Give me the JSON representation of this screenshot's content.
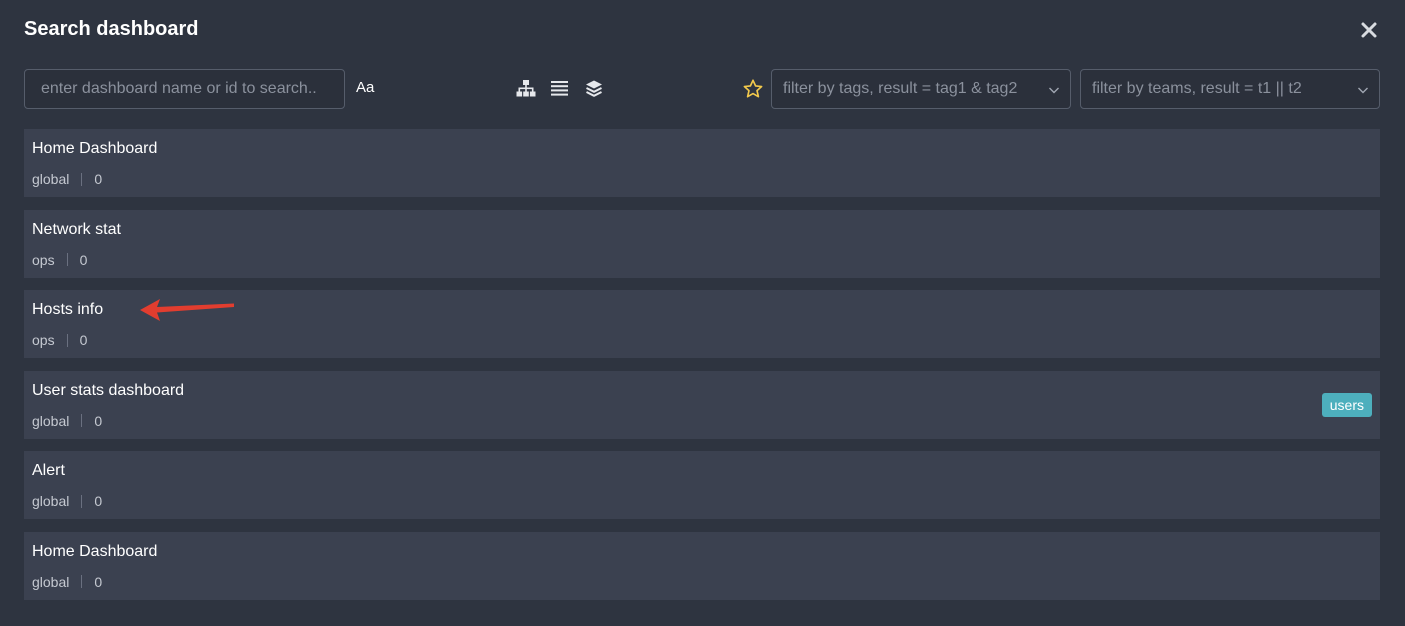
{
  "header": {
    "title": "Search dashboard"
  },
  "toolbar": {
    "search_placeholder": "enter dashboard name or id to search..",
    "case_toggle_label": "Aa",
    "tags_filter_placeholder": "filter by tags, result = tag1 & tag2",
    "teams_filter_placeholder": "filter by teams, result = t1 || t2"
  },
  "icons": {
    "close": "close-icon",
    "tree_view": "sitemap-icon",
    "list_view": "list-icon",
    "layers_view": "layers-icon",
    "starred": "star-icon",
    "dropdown": "chevron-down-icon"
  },
  "colors": {
    "background": "#2e3440",
    "row": "#3b4150",
    "tag": "#4dafbd",
    "star": "#f2c94c",
    "annotation_arrow": "#e23d2f"
  },
  "dashboards": [
    {
      "title": "Home Dashboard",
      "folder": "global",
      "count": "0",
      "tag": ""
    },
    {
      "title": "Network stat",
      "folder": "ops",
      "count": "0",
      "tag": ""
    },
    {
      "title": "Hosts info",
      "folder": "ops",
      "count": "0",
      "tag": ""
    },
    {
      "title": "User stats dashboard",
      "folder": "global",
      "count": "0",
      "tag": "users"
    },
    {
      "title": "Alert",
      "folder": "global",
      "count": "0",
      "tag": ""
    },
    {
      "title": "Home Dashboard",
      "folder": "global",
      "count": "0",
      "tag": ""
    }
  ]
}
